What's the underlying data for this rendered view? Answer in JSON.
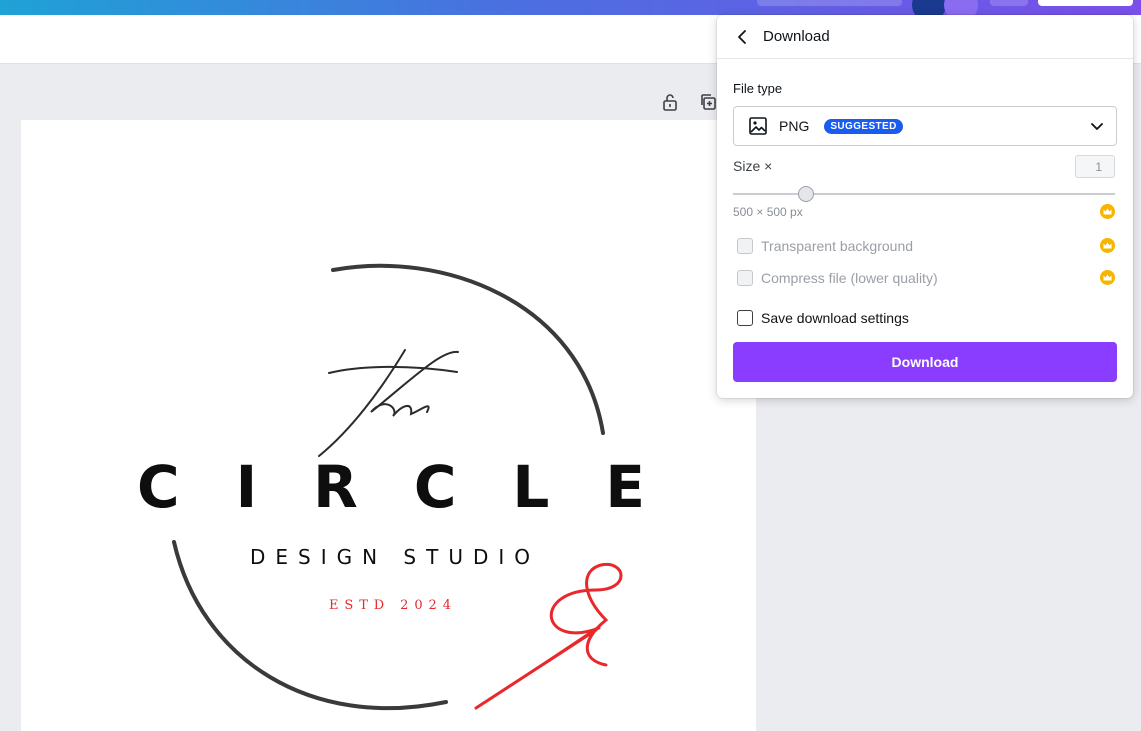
{
  "download_panel": {
    "title": "Download",
    "file_type_label": "File type",
    "file_type_value": "PNG",
    "suggested_badge": "SUGGESTED",
    "size_label": "Size ×",
    "size_value": "1",
    "size_slider_fraction": 0.19,
    "size_pixels": "500 × 500 px",
    "options": [
      {
        "label": "Transparent background",
        "checked": false,
        "enabled": false,
        "pro": true
      },
      {
        "label": "Compress file (lower quality)",
        "checked": false,
        "enabled": false,
        "pro": true
      },
      {
        "label": "Save download settings",
        "checked": false,
        "enabled": true,
        "pro": false
      }
    ],
    "download_button": "Download"
  },
  "design": {
    "script_word": "the",
    "main_word": "C I R C L E",
    "subtitle": "DESIGN STUDIO",
    "established": "ESTD 2024"
  },
  "colors": {
    "accent_purple": "#8b3dff",
    "badge_blue": "#1b5cf0",
    "crown_gold": "#f7b500",
    "needle_red": "#e8282b"
  },
  "icons": [
    "back-chevron-icon",
    "image-icon",
    "chevron-down-icon",
    "crown-icon",
    "unlock-icon",
    "duplicate-page-icon"
  ]
}
